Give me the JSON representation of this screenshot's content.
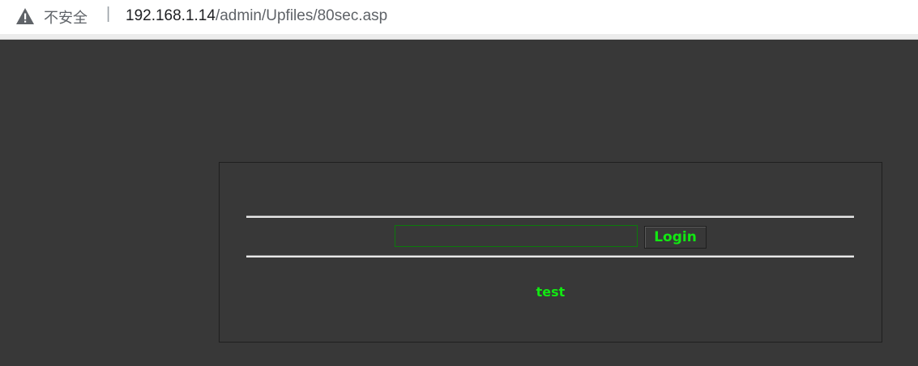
{
  "browser": {
    "security_label": "不安全",
    "separator": "|",
    "url_host": "192.168.1.14",
    "url_path": "/admin/Upfiles/80sec.asp",
    "warning_icon": "warning-triangle-icon"
  },
  "page": {
    "password_value": "",
    "login_label": "Login",
    "footer_text": "test",
    "colors": {
      "background": "#383838",
      "accent_green": "#12e812",
      "input_border": "#0c7a0c"
    }
  }
}
